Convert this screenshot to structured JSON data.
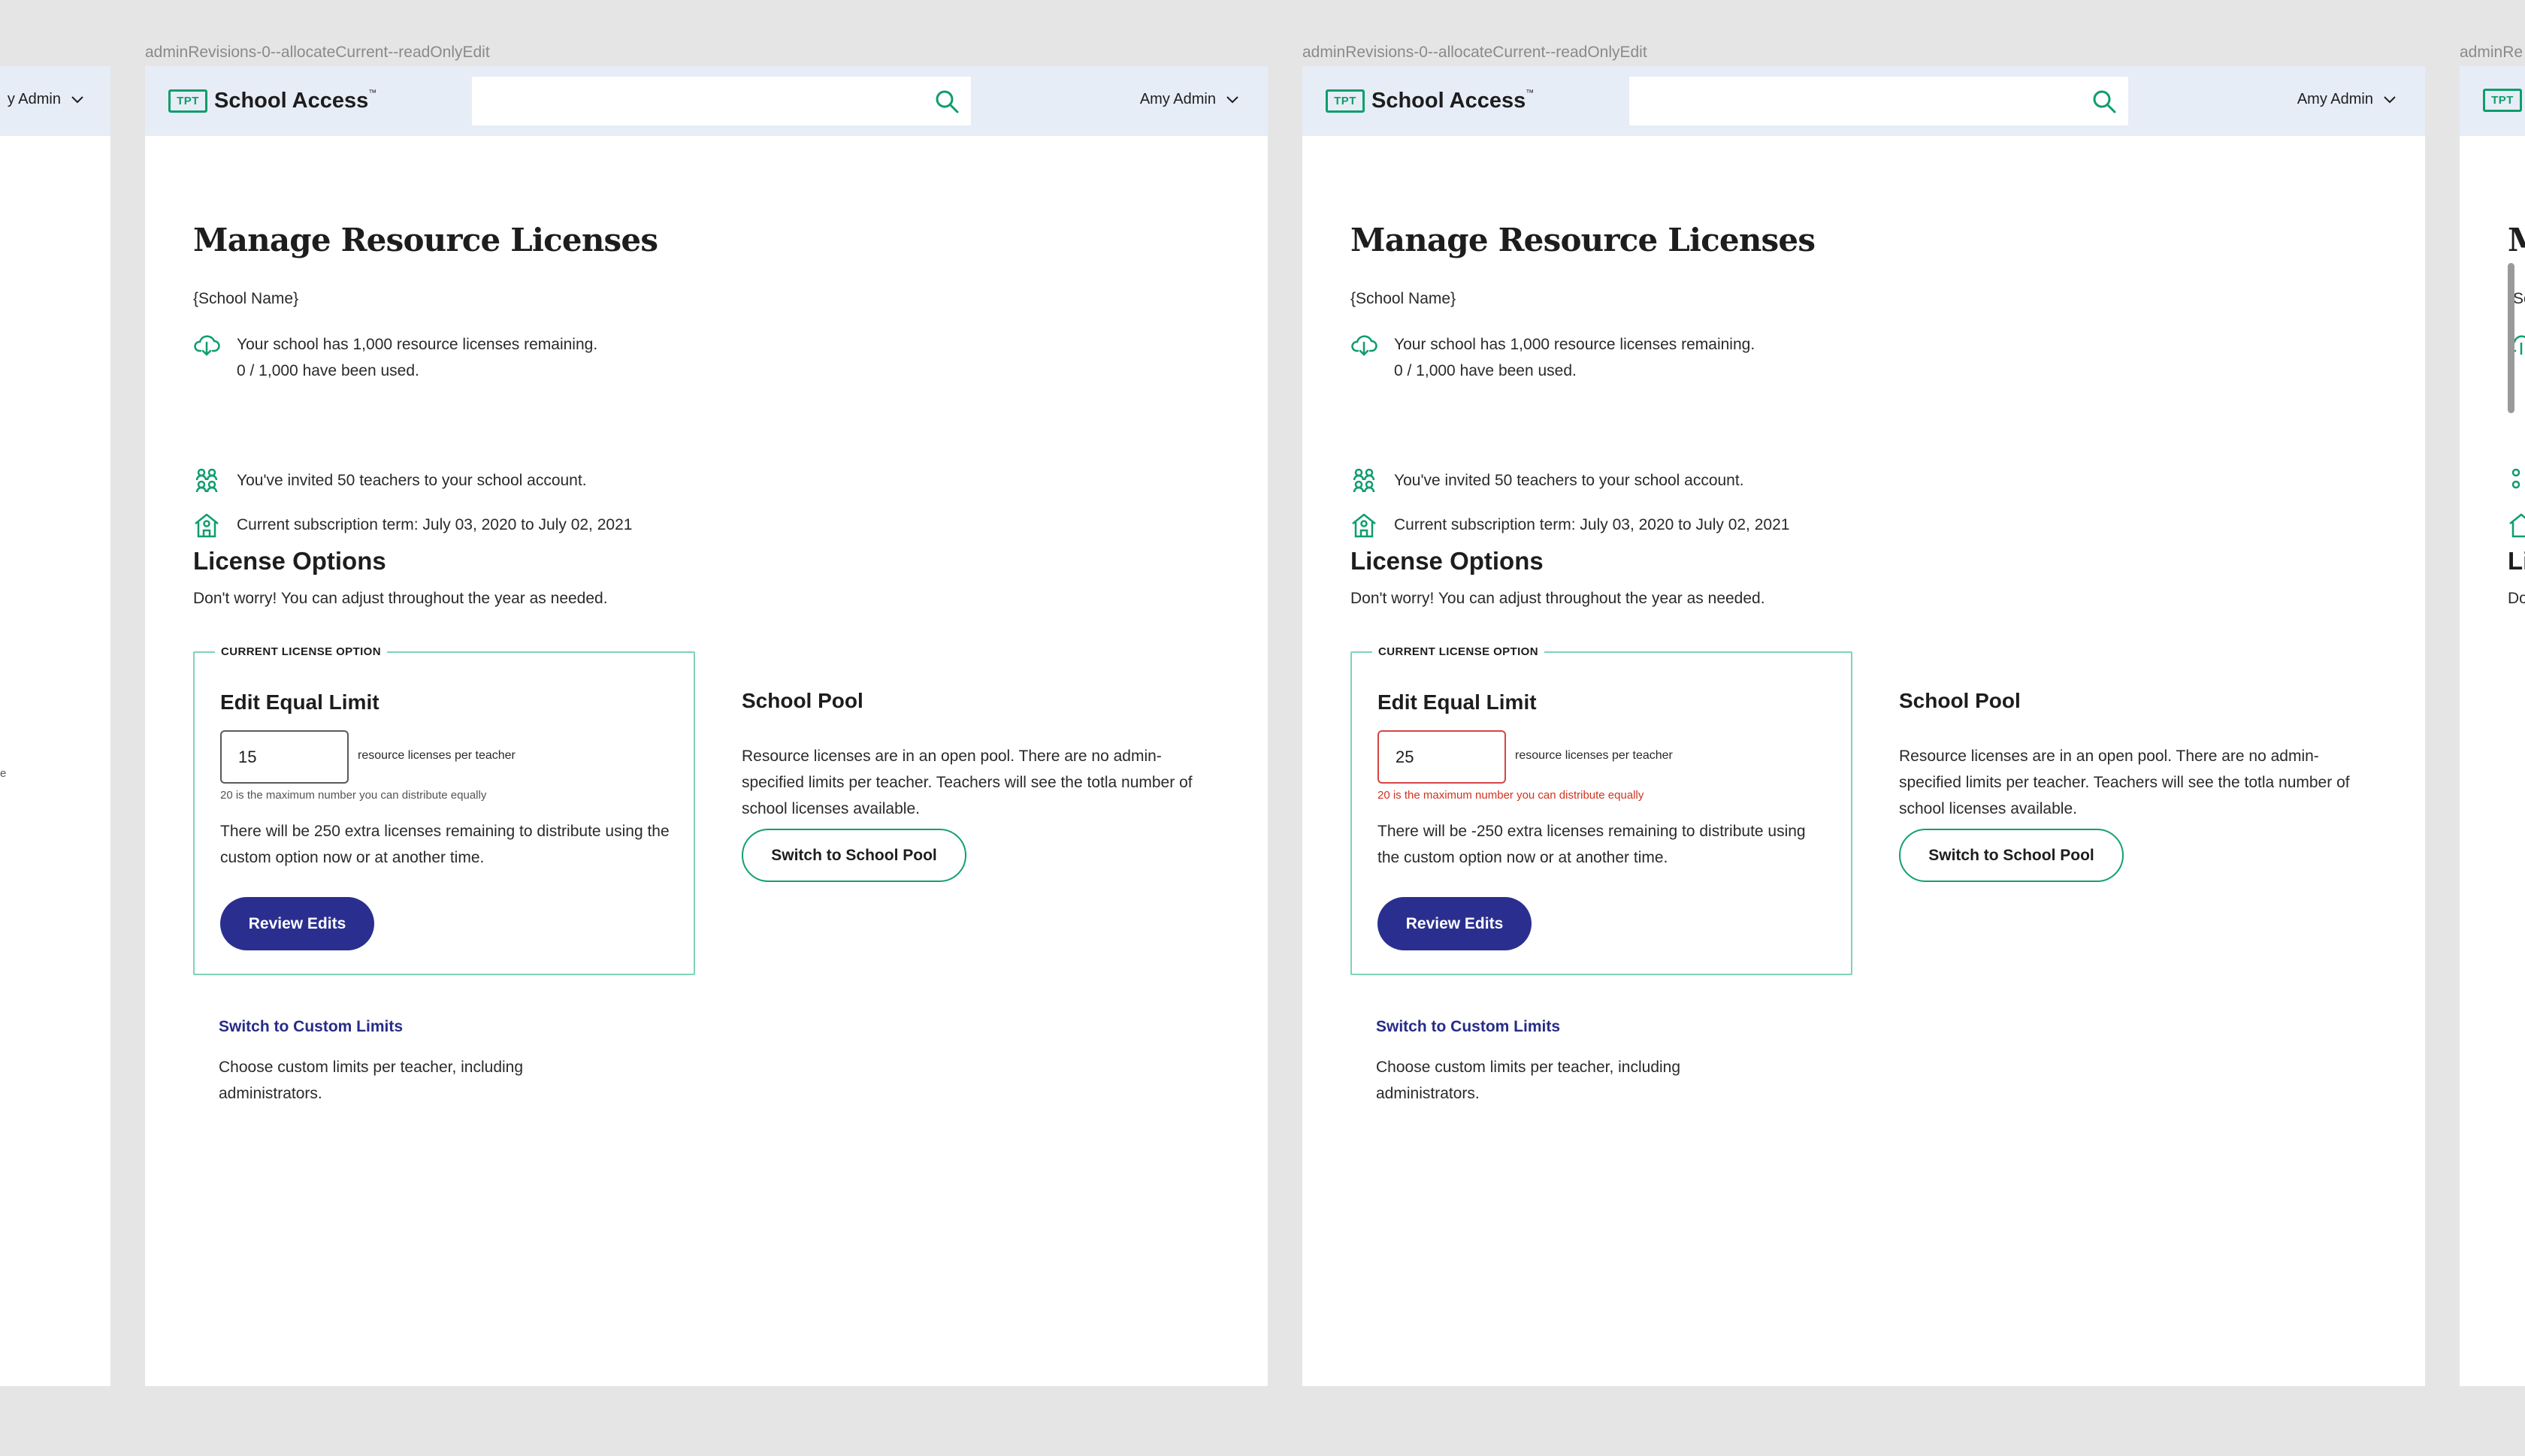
{
  "labels": {
    "frame": "adminRevisions-0--allocateCurrent--readOnlyEdit",
    "frame_cut": "adminRe"
  },
  "header": {
    "logo_box": "TPT",
    "logo_text": "School Access",
    "logo_tm": "™",
    "user_name": "Amy Admin",
    "user_name_cut": "y Admin"
  },
  "page": {
    "title": "Manage Resource Licenses",
    "title_cut": "M",
    "school_name": "{School Name}",
    "school_name_cut": "{Sc",
    "licenses_line1": "Your school has 1,000 resource licenses remaining.",
    "licenses_line2": "0 / 1,000 have been used.",
    "invited": "You've invited 50 teachers to your school account.",
    "term": "Current subscription term: July 03, 2020 to July 02, 2021"
  },
  "options": {
    "title": "License Options",
    "title_cut": "Li",
    "subtitle": "Don't worry! You can adjust throughout the year as needed.",
    "subtitle_cut": "Do",
    "current_legend": "CURRENT LICENSE OPTION",
    "equal_title": "Edit Equal Limit",
    "per_teacher": "resource licenses per teacher",
    "max_note": "20 is the maximum number you can distribute equally",
    "max_note_cut": "e",
    "review_button": "Review Edits",
    "pool_title": "School Pool",
    "pool_desc": "Resource licenses are in an open pool. There are no admin-specified limits per teacher. Teachers will see the totla number of school licenses available.",
    "pool_button": "Switch to School Pool",
    "custom_link": "Switch to Custom Limits",
    "custom_desc": "Choose custom limits per teacher, including administrators."
  },
  "frames": [
    {
      "value": "15",
      "remaining": "There will be 250 extra licenses remaining to distribute using the custom option now or at another time."
    },
    {
      "value": "25",
      "remaining": "There will be -250 extra licenses remaining to distribute using the custom option now or at another time."
    }
  ],
  "colors": {
    "brand_green": "#0f9d6b",
    "primary_navy": "#2a2f8f",
    "link_blue": "#262c88",
    "error_red": "#d0331f",
    "header_bg": "#e7edf7",
    "canvas_bg": "#e5e5e5"
  },
  "icons": {
    "search": "search-icon",
    "chevron": "chevron-down-icon",
    "licenses": "cloud-download-icon",
    "teachers": "people-icon",
    "term": "school-house-icon"
  }
}
